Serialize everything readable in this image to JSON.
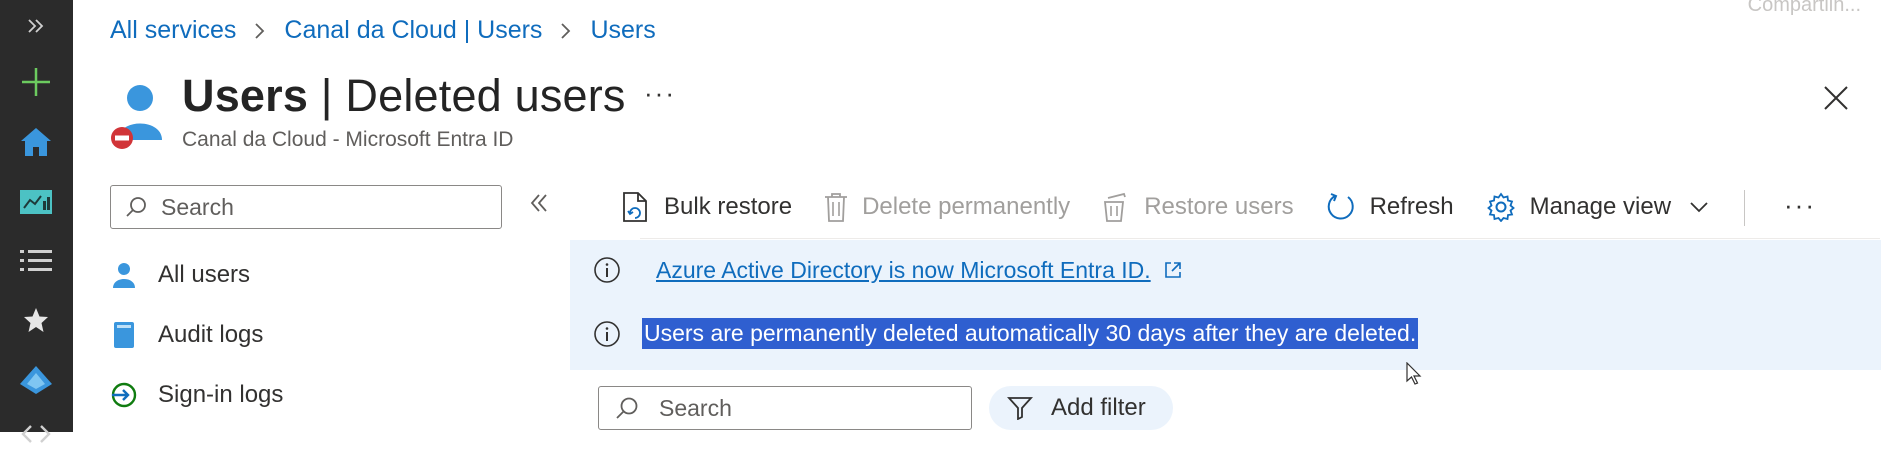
{
  "share_hint": "Compartilh...",
  "rail": {
    "items": [
      {
        "icon": "expand-chevrons-icon"
      },
      {
        "icon": "plus-icon",
        "color": "#6ccb5f"
      },
      {
        "icon": "home-icon",
        "color": "#3a96dd"
      },
      {
        "icon": "dashboard-icon",
        "color": "#4cc2c4"
      },
      {
        "icon": "list-icon"
      },
      {
        "icon": "star-icon"
      },
      {
        "icon": "entra-icon",
        "color": "#3a96dd"
      },
      {
        "icon": "code-icon"
      }
    ]
  },
  "breadcrumb": [
    "All services",
    "Canal da Cloud | Users",
    "Users"
  ],
  "header": {
    "title_main": "Users",
    "title_sep": " | ",
    "title_sub": "Deleted users",
    "more": "···",
    "subtitle": "Canal da Cloud - Microsoft Entra ID"
  },
  "left_search": {
    "placeholder": "Search"
  },
  "nav": [
    {
      "label": "All users",
      "icon": "user-icon"
    },
    {
      "label": "Audit logs",
      "icon": "audit-log-icon"
    },
    {
      "label": "Sign-in logs",
      "icon": "sign-in-icon"
    }
  ],
  "toolbar": {
    "bulk_restore": "Bulk restore",
    "delete_permanently": "Delete permanently",
    "restore_users": "Restore users",
    "refresh": "Refresh",
    "manage_view": "Manage view",
    "more": "···"
  },
  "banners": {
    "entra_link": "Azure Active Directory is now Microsoft Entra ID.",
    "retention_notice": "Users are permanently deleted automatically 30 days after they are deleted."
  },
  "grid_search": {
    "placeholder": "Search"
  },
  "add_filter": "Add filter",
  "colors": {
    "accent": "#0f6cbd",
    "rail": "#2b2b2b",
    "banner_bg": "#ebf3fc",
    "selection": "#2f5fd0"
  }
}
